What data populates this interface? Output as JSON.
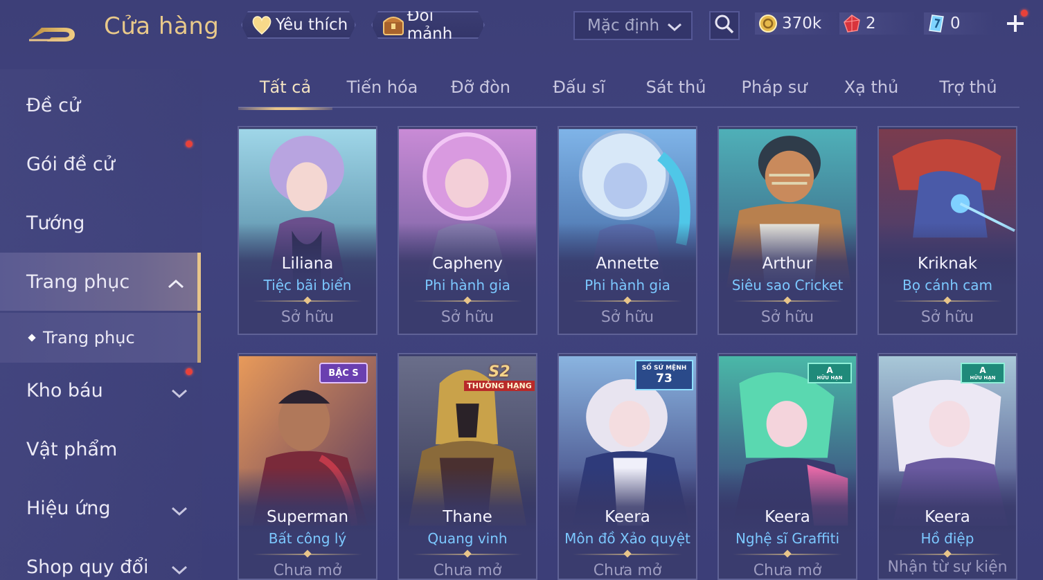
{
  "header": {
    "title": "Cửa hàng",
    "favorites_label": "Yêu thích",
    "exchange_label": "Đổi mảnh",
    "sort_value": "Mặc định",
    "icons": {
      "back": "back-arrow-icon",
      "favorites": "heart-icon",
      "exchange": "treasure-chest-icon",
      "search": "search-icon",
      "add": "plus-icon"
    }
  },
  "currencies": {
    "gold": "370k",
    "ruby": "2",
    "voucher": "0"
  },
  "sidebar": {
    "items": [
      {
        "label": "Đề cử"
      },
      {
        "label": "Gói đề cử",
        "dot": true
      },
      {
        "label": "Tướng"
      },
      {
        "label": "Trang phục",
        "expanded": true
      },
      {
        "label": "Trang phục"
      },
      {
        "label": "Kho báu",
        "dot": true
      },
      {
        "label": "Vật phẩm"
      },
      {
        "label": "Hiệu ứng"
      },
      {
        "label": "Shop quy đổi"
      }
    ]
  },
  "tabs": [
    "Tất cả",
    "Tiến hóa",
    "Đỡ đòn",
    "Đấu sĩ",
    "Sát thủ",
    "Pháp sư",
    "Xạ thủ",
    "Trợ thủ"
  ],
  "active_tab": "Tất cả",
  "cards": [
    {
      "hero": "Liliana",
      "skin": "Tiệc bãi biển",
      "status": "Sở hữu"
    },
    {
      "hero": "Capheny",
      "skin": "Phi hành gia",
      "status": "Sở hữu"
    },
    {
      "hero": "Annette",
      "skin": "Phi hành gia",
      "status": "Sở hữu"
    },
    {
      "hero": "Arthur",
      "skin": "Siêu sao Cricket",
      "status": "Sở hữu"
    },
    {
      "hero": "Kriknak",
      "skin": "Bọ cánh cam",
      "status": "Sở hữu"
    },
    {
      "hero": "Superman",
      "skin": "Bất công lý",
      "status": "Chưa mở",
      "badge": "BẬC S"
    },
    {
      "hero": "Thane",
      "skin": "Quang vinh",
      "status": "Chưa mở",
      "badge": "S2",
      "badge2": "THƯỞNG HẠNG"
    },
    {
      "hero": "Keera",
      "skin": "Môn đồ Xảo quyệt",
      "status": "Chưa mở",
      "badge": "SỔ SỨ MỆNH",
      "badge2": "73"
    },
    {
      "hero": "Keera",
      "skin": "Nghệ sĩ Graffiti",
      "status": "Chưa mở",
      "badge": "A",
      "badge2": "HỮU HẠN"
    },
    {
      "hero": "Keera",
      "skin": "Hồ điệp",
      "status": "Nhận từ sự kiện",
      "badge": "A",
      "badge2": "HỮU HẠN"
    }
  ],
  "colors": {
    "accent_gold": "#e8c58a",
    "skin_blue": "#7cc8ff",
    "background": "#3f417c",
    "notification_red": "#e8413a"
  }
}
